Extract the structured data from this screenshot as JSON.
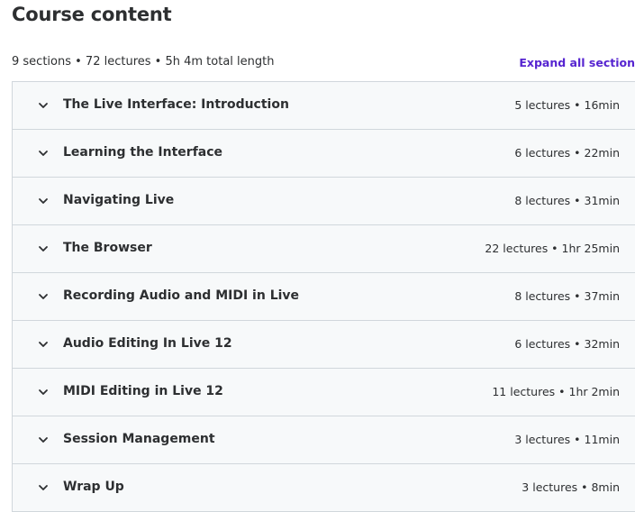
{
  "header": {
    "title": "Course content",
    "summary": "9 sections • 72 lectures • 5h 4m total length",
    "expand_all_label": "Expand all section"
  },
  "colors": {
    "accent": "#5624d0",
    "section_bg": "#f7f9fa",
    "border": "#d1d7dc",
    "text": "#2d2f31"
  },
  "sections": [
    {
      "title": "The Live Interface: Introduction",
      "meta": "5 lectures • 16min",
      "icon": "chevron-down-icon"
    },
    {
      "title": "Learning the Interface",
      "meta": "6 lectures • 22min",
      "icon": "chevron-down-icon"
    },
    {
      "title": "Navigating Live",
      "meta": "8 lectures • 31min",
      "icon": "chevron-down-icon"
    },
    {
      "title": "The Browser",
      "meta": "22 lectures • 1hr 25min",
      "icon": "chevron-down-icon"
    },
    {
      "title": "Recording Audio and MIDI in Live",
      "meta": "8 lectures • 37min",
      "icon": "chevron-down-icon"
    },
    {
      "title": "Audio Editing In Live 12",
      "meta": "6 lectures • 32min",
      "icon": "chevron-down-icon"
    },
    {
      "title": "MIDI Editing in Live 12",
      "meta": "11 lectures • 1hr 2min",
      "icon": "chevron-down-icon"
    },
    {
      "title": "Session Management",
      "meta": "3 lectures • 11min",
      "icon": "chevron-down-icon"
    },
    {
      "title": "Wrap Up",
      "meta": "3 lectures • 8min",
      "icon": "chevron-down-icon"
    }
  ]
}
